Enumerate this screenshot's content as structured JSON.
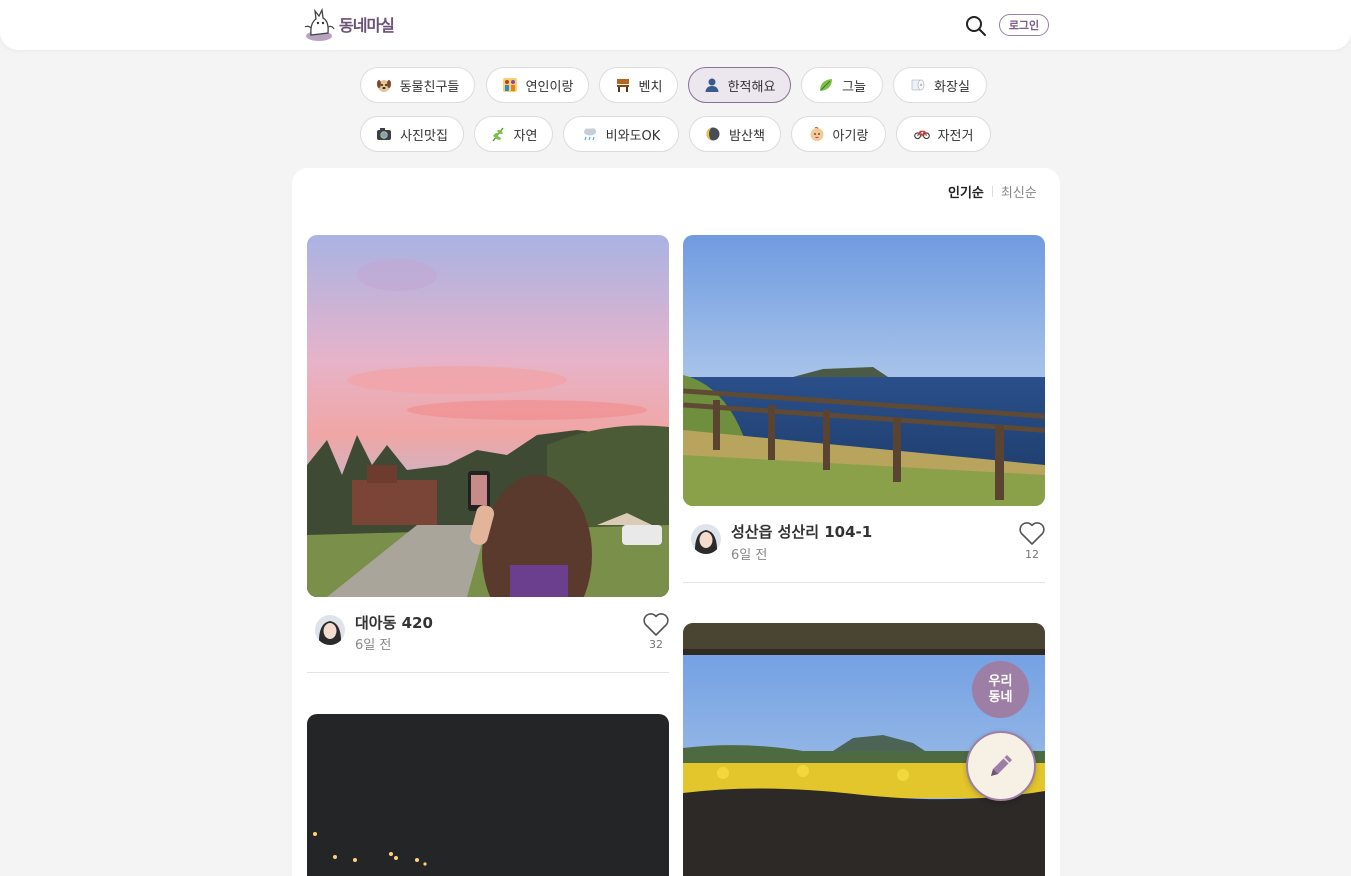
{
  "header": {
    "logo_text": "동네마실",
    "login_label": "로그인"
  },
  "categories_row1": [
    {
      "label": "동물친구들",
      "icon": "puppy-icon"
    },
    {
      "label": "연인이랑",
      "icon": "couple-icon"
    },
    {
      "label": "벤치",
      "icon": "bench-icon"
    },
    {
      "label": "한적해요",
      "icon": "person-icon",
      "active": true
    },
    {
      "label": "그늘",
      "icon": "leaf-icon"
    },
    {
      "label": "화장실",
      "icon": "toilet-paper-icon"
    }
  ],
  "categories_row2": [
    {
      "label": "사진맛집",
      "icon": "camera-icon"
    },
    {
      "label": "자연",
      "icon": "herb-icon"
    },
    {
      "label": "비와도OK",
      "icon": "rain-cloud-icon"
    },
    {
      "label": "밤산책",
      "icon": "moon-icon"
    },
    {
      "label": "아기랑",
      "icon": "baby-icon"
    },
    {
      "label": "자전거",
      "icon": "bicycle-icon"
    }
  ],
  "sort": {
    "popular": "인기순",
    "latest": "최신순"
  },
  "posts": [
    {
      "title": "대아동 420",
      "time": "6일 전",
      "likes": "32"
    },
    {
      "title": "성산읍 성산리 104-1",
      "time": "6일 전",
      "likes": "12"
    }
  ],
  "fab": {
    "town_line1": "우리",
    "town_line2": "동네"
  },
  "colors": {
    "brand": "#9d7fa5",
    "active_chip_bg": "#ece6ef"
  }
}
